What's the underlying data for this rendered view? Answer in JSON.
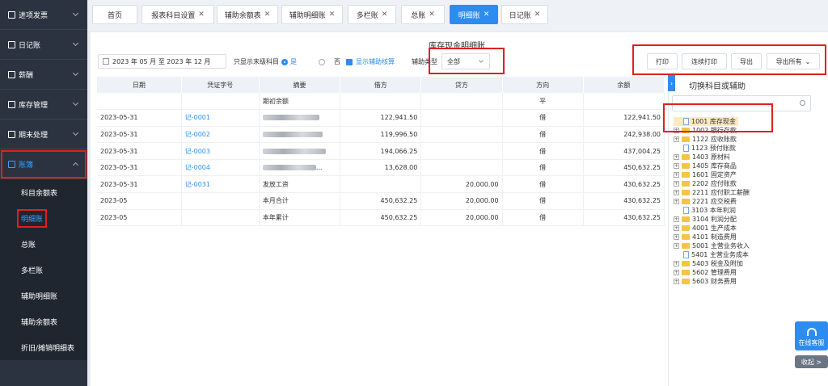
{
  "sidebar": {
    "items": [
      {
        "label": "进项发票"
      },
      {
        "label": "日记账"
      },
      {
        "label": "薪酬"
      },
      {
        "label": "库存管理"
      },
      {
        "label": "期末处理"
      },
      {
        "label": "账簿"
      }
    ],
    "sub_items": [
      {
        "label": "科目余额表"
      },
      {
        "label": "明细账"
      },
      {
        "label": "总账"
      },
      {
        "label": "多栏账"
      },
      {
        "label": "辅助明细账"
      },
      {
        "label": "辅助余额表"
      },
      {
        "label": "折旧/摊销明细表"
      }
    ]
  },
  "tabs": [
    {
      "label": "首页"
    },
    {
      "label": "报表科目设置"
    },
    {
      "label": "辅助余额表"
    },
    {
      "label": "辅助明细账"
    },
    {
      "label": "多栏账"
    },
    {
      "label": "总账"
    },
    {
      "label": "明细账"
    },
    {
      "label": "日记账"
    }
  ],
  "toolbar": {
    "title": "库存现金明细账",
    "date_range": "2023 年 05 月 至 2023 年 12 月",
    "only_leaf_label": "只显示末级科目",
    "yes": "是",
    "no": "否",
    "show_aux": "显示辅助核算",
    "aux_type_label": "辅助类型",
    "aux_type_value": "全部",
    "print": "打印",
    "batch_print": "连续打印",
    "export": "导出",
    "export_all": "导出所有"
  },
  "table": {
    "headers": [
      "日期",
      "凭证字号",
      "摘要",
      "借方",
      "贷方",
      "方向",
      "余额"
    ],
    "rows": [
      {
        "date": "",
        "voucher": "",
        "summary": "期初余额",
        "debit": "",
        "credit": "",
        "dir": "平",
        "balance": ""
      },
      {
        "date": "2023-05-31",
        "voucher": "记-0001",
        "summary": "",
        "debit": "122,941.50",
        "credit": "",
        "dir": "借",
        "balance": "122,941.50"
      },
      {
        "date": "2023-05-31",
        "voucher": "记-0002",
        "summary": "",
        "debit": "119,996.50",
        "credit": "",
        "dir": "借",
        "balance": "242,938.00"
      },
      {
        "date": "2023-05-31",
        "voucher": "记-0003",
        "summary": "",
        "debit": "194,066.25",
        "credit": "",
        "dir": "借",
        "balance": "437,004.25"
      },
      {
        "date": "2023-05-31",
        "voucher": "记-0004",
        "summary": "...",
        "debit": "13,628.00",
        "credit": "",
        "dir": "借",
        "balance": "450,632.25"
      },
      {
        "date": "2023-05-31",
        "voucher": "记-0031",
        "summary": "发放工资",
        "debit": "",
        "credit": "20,000.00",
        "dir": "借",
        "balance": "430,632.25"
      },
      {
        "date": "2023-05",
        "voucher": "",
        "summary": "本月合计",
        "debit": "450,632.25",
        "credit": "20,000.00",
        "dir": "借",
        "balance": "430,632.25"
      },
      {
        "date": "2023-05",
        "voucher": "",
        "summary": "本年累计",
        "debit": "450,632.25",
        "credit": "20,000.00",
        "dir": "借",
        "balance": "430,632.25"
      }
    ]
  },
  "panel": {
    "title": "切换科目或辅助",
    "tree": [
      {
        "label": "1001 库存现金",
        "type": "file"
      },
      {
        "label": "1002 银行存款",
        "type": "folder"
      },
      {
        "label": "1122 应收账款",
        "type": "folder"
      },
      {
        "label": "1123 预付账款",
        "type": "file"
      },
      {
        "label": "1403 原材料",
        "type": "folder"
      },
      {
        "label": "1405 库存商品",
        "type": "folder"
      },
      {
        "label": "1601 固定资产",
        "type": "folder"
      },
      {
        "label": "2202 应付账款",
        "type": "folder"
      },
      {
        "label": "2211 应付职工薪酬",
        "type": "folder"
      },
      {
        "label": "2221 应交税费",
        "type": "folder"
      },
      {
        "label": "3103 本年利润",
        "type": "file"
      },
      {
        "label": "3104 利润分配",
        "type": "folder"
      },
      {
        "label": "4001 生产成本",
        "type": "folder"
      },
      {
        "label": "4101 制造费用",
        "type": "folder"
      },
      {
        "label": "5001 主营业务收入",
        "type": "folder"
      },
      {
        "label": "5401 主营业务成本",
        "type": "file"
      },
      {
        "label": "5403 税金及附加",
        "type": "folder"
      },
      {
        "label": "5602 管理费用",
        "type": "folder"
      },
      {
        "label": "5603 财务费用",
        "type": "folder"
      }
    ]
  },
  "float": {
    "service": "在线客服",
    "collapse": "收起 >"
  }
}
